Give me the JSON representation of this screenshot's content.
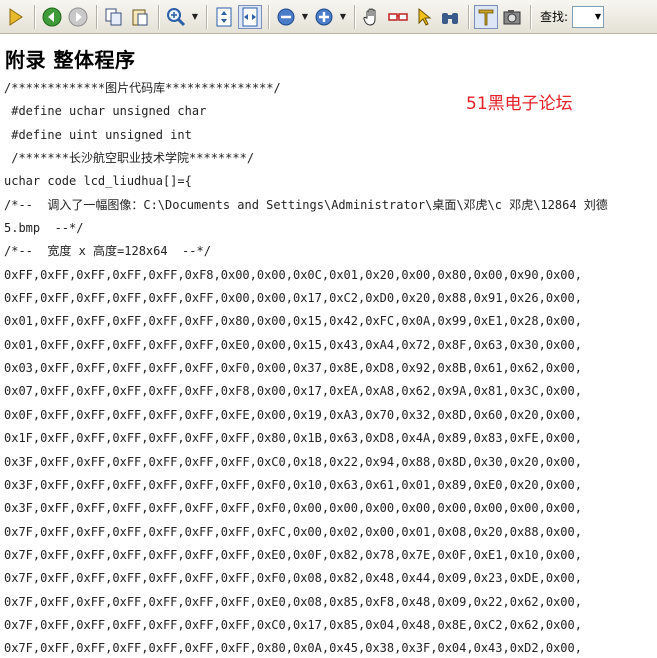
{
  "toolbar": {
    "find_label": "查找:",
    "buttons": [
      {
        "name": "play-icon"
      },
      {
        "name": "back-icon"
      },
      {
        "name": "forward-icon"
      },
      {
        "name": "copy-icon"
      },
      {
        "name": "paste-icon"
      },
      {
        "name": "zoom-in-icon"
      },
      {
        "name": "fit-page-icon"
      },
      {
        "name": "fit-width-icon"
      },
      {
        "name": "zoom-out-circle-icon"
      },
      {
        "name": "zoom-in-circle-icon"
      },
      {
        "name": "hand-tool-icon"
      },
      {
        "name": "glasses-icon"
      },
      {
        "name": "select-arrow-icon"
      },
      {
        "name": "binoculars-icon"
      },
      {
        "name": "text-select-icon"
      },
      {
        "name": "snapshot-camera-icon"
      }
    ]
  },
  "document": {
    "heading": "附录 整体程序",
    "watermark": "51黑电子论坛",
    "lines": [
      "/*************图片代码库***************/",
      " #define uchar unsigned char",
      " #define uint unsigned int",
      " /*******长沙航空职业技术学院********/",
      "uchar code lcd_liudhua[]={",
      "/*--  调入了一幅图像：C:\\Documents and Settings\\Administrator\\桌面\\邓虎\\c 邓虎\\12864 刘德",
      "5.bmp  --*/",
      "/*--  宽度 x 高度=128x64  --*/",
      "0xFF,0xFF,0xFF,0xFF,0xFF,0xF8,0x00,0x00,0x0C,0x01,0x20,0x00,0x80,0x00,0x90,0x00,",
      "0xFF,0xFF,0xFF,0xFF,0xFF,0xFF,0x00,0x00,0x17,0xC2,0xD0,0x20,0x88,0x91,0x26,0x00,",
      "0x01,0xFF,0xFF,0xFF,0xFF,0xFF,0x80,0x00,0x15,0x42,0xFC,0x0A,0x99,0xE1,0x28,0x00,",
      "0x01,0xFF,0xFF,0xFF,0xFF,0xFF,0xE0,0x00,0x15,0x43,0xA4,0x72,0x8F,0x63,0x30,0x00,",
      "0x03,0xFF,0xFF,0xFF,0xFF,0xFF,0xF0,0x00,0x37,0x8E,0xD8,0x92,0x8B,0x61,0x62,0x00,",
      "0x07,0xFF,0xFF,0xFF,0xFF,0xFF,0xF8,0x00,0x17,0xEA,0xA8,0x62,0x9A,0x81,0x3C,0x00,",
      "0x0F,0xFF,0xFF,0xFF,0xFF,0xFF,0xFE,0x00,0x19,0xA3,0x70,0x32,0x8D,0x60,0x20,0x00,",
      "0x1F,0xFF,0xFF,0xFF,0xFF,0xFF,0xFF,0x80,0x1B,0x63,0xD8,0x4A,0x89,0x83,0xFE,0x00,",
      "0x3F,0xFF,0xFF,0xFF,0xFF,0xFF,0xFF,0xC0,0x18,0x22,0x94,0x88,0x8D,0x30,0x20,0x00,",
      "0x3F,0xFF,0xFF,0xFF,0xFF,0xFF,0xFF,0xF0,0x10,0x63,0x61,0x01,0x89,0xE0,0x20,0x00,",
      "0x3F,0xFF,0xFF,0xFF,0xFF,0xFF,0xFF,0xF0,0x00,0x00,0x00,0x00,0x00,0x00,0x00,0x00,",
      "0x7F,0xFF,0xFF,0xFF,0xFF,0xFF,0xFF,0xFC,0x00,0x02,0x00,0x01,0x08,0x20,0x88,0x00,",
      "0x7F,0xFF,0xFF,0xFF,0xFF,0xFF,0xFF,0xE0,0x0F,0x82,0x78,0x7E,0x0F,0xE1,0x10,0x00,",
      "0x7F,0xFF,0xFF,0xFF,0xFF,0xFF,0xFF,0xF0,0x08,0x82,0x48,0x44,0x09,0x23,0xDE,0x00,",
      "0x7F,0xFF,0xFF,0xFF,0xFF,0xFF,0xFF,0xE0,0x08,0x85,0xF8,0x48,0x09,0x22,0x62,0x00,",
      "0x7F,0xFF,0xFF,0xFF,0xFF,0xFF,0xFF,0xC0,0x17,0x85,0x04,0x48,0x8E,0xC2,0x62,0x00,",
      "0x7F,0xFF,0xFF,0xFF,0xFF,0xFF,0xFF,0x80,0x0A,0x45,0x38,0x3F,0x04,0x43,0xD2,0x00,"
    ]
  }
}
